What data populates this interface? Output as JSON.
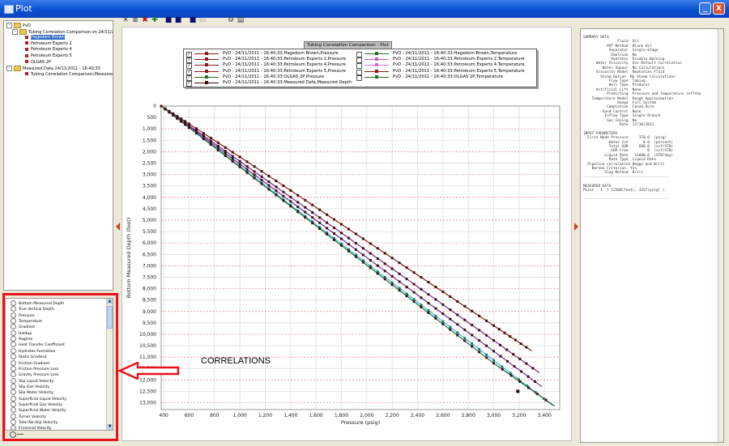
{
  "window": {
    "title": "Plot",
    "minimize_glyph": "_",
    "close_glyph": "X"
  },
  "tree": {
    "items": [
      {
        "type": "folder",
        "expander": "-",
        "label": "PvD"
      },
      {
        "type": "folder",
        "expander": "-",
        "label": "Tubing Correlation Comparison on 24/11/2011 - ..."
      },
      {
        "type": "leaf",
        "label": "Hagedorn Brown",
        "selected": true
      },
      {
        "type": "leaf",
        "label": "Petroleum Experts 2"
      },
      {
        "type": "leaf",
        "label": "Petroleum Experts 4"
      },
      {
        "type": "leaf",
        "label": "Petroleum Experts 5"
      },
      {
        "type": "leaf",
        "label": "OLGAS 2P"
      },
      {
        "type": "folder",
        "expander": "-",
        "label": "Measured Data 24/11/2011 - 16:40:33"
      },
      {
        "type": "leaf",
        "label": "Tubing Correlation Comparison;Measured"
      }
    ]
  },
  "variables": {
    "items": [
      "Bottom Measured Depth",
      "True Vertical Depth",
      "Pressure",
      "Temperature",
      "Gradient",
      "Holdup",
      "Regime",
      "Heat Transfer Coefficient",
      "Hydrates Formation",
      "Static Gradient",
      "Friction Gradient",
      "Friction Pressure Loss",
      "Gravity Pressure Loss",
      "Slip Liquid Velocity",
      "Slip Gas Velocity",
      "Slip Water Velocity",
      "Superficial Liquid Velocity",
      "Superficial Gas Velocity",
      "Superficial Water Velocity",
      "Turner Velocity",
      "Total No-Slip Velocity",
      "Erosional Velocity"
    ],
    "scroll_up": "▲",
    "scroll_down": "▼"
  },
  "toolbar": {
    "icons": [
      "axes-icon",
      "grid-icon",
      "delete-icon",
      "add-icon",
      "save-icon",
      "save-as-icon",
      "export-icon",
      "copy-icon",
      "settings-icon",
      "print-icon"
    ]
  },
  "annotation": {
    "text": "CORRELATIONS",
    "highlight_color": "#e8121c"
  },
  "chart_data": {
    "type": "line",
    "title": "Tubing Correlation Comparison - Plot",
    "xlabel": "Pressure (psig)",
    "ylabel": "Bottom Measured Depth (feet)",
    "xlim": [
      380,
      3520
    ],
    "ylim": [
      13300,
      0
    ],
    "x_ticks": [
      400,
      600,
      800,
      1000,
      1200,
      1400,
      1600,
      1800,
      2000,
      2200,
      2400,
      2600,
      2800,
      3000,
      3200,
      3400
    ],
    "y_ticks": [
      0,
      500,
      1000,
      1500,
      2000,
      2500,
      3000,
      3500,
      4000,
      4500,
      5000,
      5500,
      6000,
      6500,
      7000,
      7500,
      8000,
      8500,
      9000,
      9500,
      10000,
      10500,
      11000,
      11500,
      12000,
      12500,
      13000
    ],
    "grid": true,
    "legend_position": "top",
    "series": [
      {
        "name": "PvD - 24/11/2011 - 16:40:33:Hagedorn Brown,Pressure",
        "color": "#8b1a1a",
        "checked": true,
        "x": [
          380,
          600,
          1000,
          1400,
          1800,
          2200,
          2600,
          3000,
          3300
        ],
        "y": [
          0,
          780,
          2230,
          3700,
          5180,
          6660,
          8140,
          9620,
          10730
        ]
      },
      {
        "name": "PvD - 24/11/2011 - 16:40:33:Petroleum Experts 2,Pressure",
        "color": "#8b1a1a",
        "checked": true,
        "x": [
          380,
          600,
          1000,
          1400,
          1800,
          2200,
          2600,
          3000,
          3360
        ],
        "y": [
          0,
          860,
          2420,
          3990,
          5560,
          7130,
          8700,
          10270,
          11690
        ]
      },
      {
        "name": "PvD - 24/11/2011 - 16:40:33:Petroleum Experts 4,Pressure",
        "color": "#8b1a1a",
        "checked": true,
        "x": [
          380,
          600,
          1000,
          1400,
          1800,
          2200,
          2600,
          3000,
          3380
        ],
        "y": [
          0,
          900,
          2540,
          4180,
          5820,
          7460,
          9100,
          10740,
          12300
        ]
      },
      {
        "name": "PvD - 24/11/2011 - 16:40:33:Petroleum Experts 5,Pressure",
        "color": "#8b1a1a",
        "checked": true,
        "x": [
          380,
          600,
          1000,
          1400,
          1800,
          2200,
          2600,
          3000,
          3460
        ],
        "y": [
          0,
          940,
          2640,
          4340,
          6040,
          7740,
          9440,
          11140,
          13100
        ]
      },
      {
        "name": "PvD - 24/11/2011 - 16:40:33:OLGAS 2P,Pressure",
        "color": "#2b6b2b",
        "checked": true,
        "x": [
          380,
          600,
          1000,
          1400,
          1800,
          2200,
          2600,
          3000,
          3480
        ],
        "y": [
          0,
          950,
          2670,
          4390,
          6110,
          7830,
          9550,
          11270,
          13150
        ]
      },
      {
        "name": "PvD - 24/11/2011 - 16:40:33:Measured Data,Measured Depth",
        "color": "#3a0a0a",
        "checked": true,
        "x": [
          3190
        ],
        "y": [
          12500
        ]
      },
      {
        "name": "PvD - 24/11/2011 - 16:40:33:Hagedorn Brown,Temperature",
        "color": "#2b6b2b",
        "checked": false
      },
      {
        "name": "PvD - 24/11/2011 - 16:40:33:Petroleum Experts 2,Temperature",
        "color": "#c060c0",
        "checked": false
      },
      {
        "name": "PvD - 24/11/2011 - 16:40:33:Petroleum Experts 4,Temperature",
        "color": "#d070d0",
        "checked": false
      },
      {
        "name": "PvD - 24/11/2011 - 16:40:33:Petroleum Experts 5,Temperature",
        "color": "#8b1a1a",
        "checked": false
      },
      {
        "name": "PvD - 24/11/2011 - 16:40:33:OLGAS 2P,Temperature",
        "color": "#2b6b2b",
        "checked": false
      }
    ]
  },
  "summary": {
    "lines": [
      "SUMMARY DATA",
      "                Fluid  Oil",
      "           PVT Method  Black Oil",
      "            Separator  Single-Stage",
      "             Emulsion  No",
      "             Hydrates  Disable Warning",
      "      Water Viscosity  Use Default Correlation",
      "         Water Vapour  No Calculations",
      "      Viscosity Model  Newtonian Fluid",
      "        Steam Option  No Steam Calculations",
      "            Flow Type  Tubing",
      "            Well Type  Producer",
      "      Artificial Lift  None",
      "           Predicting  Pressure and Temperature (offsho",
      "    Temperature Model  Rough Approximation",
      "                Range  Full System",
      "           Completion  Cased Hole",
      "         Sand Control  None",
      "          Inflow Type  Single Branch",
      "           Gas Coning  No",
      "                 Date  17/10/2011",
      "",
      "INPUT PARAMETERS",
      "  First Node Pressure     370.0  (psig)",
      "            Water Cut       0.0  (percent)",
      "            Total GOR     600.0  (scf/STB)",
      "             GOR Free         0  (scf/STB)",
      "          Liquid Rate   11000.0  (STB/day)",
      "            Rate Type  Liquid Rate",
      "  Pipeline correlation Beggs and Brill",
      "    Barnea Criterion  Yes",
      "          Slug Method  Brill",
      "----------------------------------------",
      "",
      "MEASURED DATA",
      "Point - 1  ( 12500(feet), 3257(psig) )",
      "",
      "----------------------------------------"
    ]
  }
}
